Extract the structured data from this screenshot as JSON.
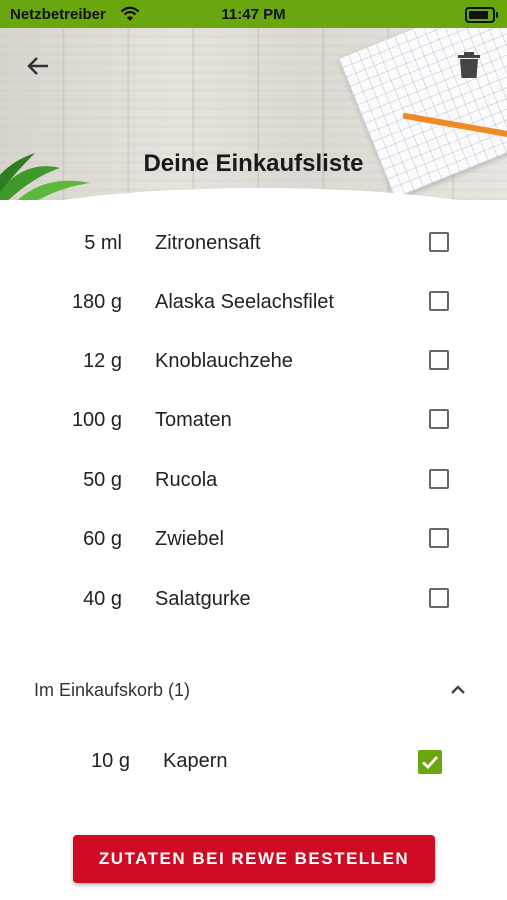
{
  "status_bar": {
    "carrier": "Netzbetreiber",
    "time": "11:47 PM"
  },
  "header": {
    "title": "Deine Einkaufsliste",
    "back_icon": "arrow-left-icon",
    "delete_icon": "trash-icon"
  },
  "items": [
    {
      "qty": "5 ml",
      "name": "Zitronensaft",
      "checked": false
    },
    {
      "qty": "180 g",
      "name": "Alaska Seelachsfilet",
      "checked": false
    },
    {
      "qty": "12 g",
      "name": "Knoblauchzehe",
      "checked": false
    },
    {
      "qty": "100 g",
      "name": "Tomaten",
      "checked": false
    },
    {
      "qty": "50 g",
      "name": "Rucola",
      "checked": false
    },
    {
      "qty": "60 g",
      "name": "Zwiebel",
      "checked": false
    },
    {
      "qty": "40 g",
      "name": "Salatgurke",
      "checked": false
    }
  ],
  "basket": {
    "label": "Im Einkaufskorb (1)",
    "chevron_icon": "chevron-up-icon",
    "items": [
      {
        "qty": "10 g",
        "name": "Kapern",
        "checked": true
      }
    ]
  },
  "order_button": {
    "label": "ZUTATEN BEI REWE BESTELLEN"
  },
  "colors": {
    "status_bar": "#6aa70e",
    "check_green": "#6aa70e",
    "button_red": "#d10a23"
  }
}
